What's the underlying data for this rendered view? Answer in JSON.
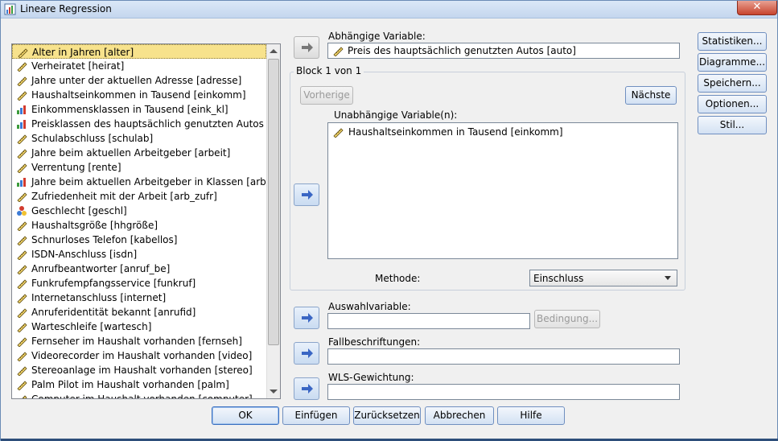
{
  "window": {
    "title": "Lineare Regression",
    "close_label": "✕"
  },
  "source_list": {
    "items": [
      {
        "label": "Alter in Jahren [alter]",
        "icon": "scale-icon",
        "selected": true
      },
      {
        "label": "Verheiratet [heirat]",
        "icon": "scale-icon"
      },
      {
        "label": "Jahre unter der aktuellen Adresse [adresse]",
        "icon": "scale-icon"
      },
      {
        "label": "Haushaltseinkommen in Tausend [einkomm]",
        "icon": "scale-icon"
      },
      {
        "label": "Einkommensklassen in Tausend [eink_kl]",
        "icon": "ordinal-icon"
      },
      {
        "label": "Preisklassen des hauptsächlich genutzten Autos [a...",
        "icon": "ordinal-icon"
      },
      {
        "label": "Schulabschluss [schulab]",
        "icon": "scale-icon"
      },
      {
        "label": "Jahre beim aktuellen Arbeitgeber [arbeit]",
        "icon": "scale-icon"
      },
      {
        "label": "Verrentung [rente]",
        "icon": "scale-icon"
      },
      {
        "label": "Jahre beim aktuellen Arbeitgeber in Klassen [arbei...",
        "icon": "ordinal-icon"
      },
      {
        "label": "Zufriedenheit mit der Arbeit [arb_zufr]",
        "icon": "scale-icon"
      },
      {
        "label": "Geschlecht [geschl]",
        "icon": "nominal-icon"
      },
      {
        "label": "Haushaltsgröße [hhgröße]",
        "icon": "scale-icon"
      },
      {
        "label": "Schnurloses Telefon [kabellos]",
        "icon": "scale-icon"
      },
      {
        "label": "ISDN-Anschluss [isdn]",
        "icon": "scale-icon"
      },
      {
        "label": "Anrufbeantworter [anruf_be]",
        "icon": "scale-icon"
      },
      {
        "label": "Funkrufempfangsservice [funkruf]",
        "icon": "scale-icon"
      },
      {
        "label": "Internetanschluss [internet]",
        "icon": "scale-icon"
      },
      {
        "label": "Anruferidentität bekannt [anrufid]",
        "icon": "scale-icon"
      },
      {
        "label": "Warteschleife [wartesch]",
        "icon": "scale-icon"
      },
      {
        "label": "Fernseher im Haushalt vorhanden [fernseh]",
        "icon": "scale-icon"
      },
      {
        "label": "Videorecorder im Haushalt vorhanden [video]",
        "icon": "scale-icon"
      },
      {
        "label": "Stereoanlage im Haushalt vorhanden [stereo]",
        "icon": "scale-icon"
      },
      {
        "label": "Palm Pilot im Haushalt vorhanden [palm]",
        "icon": "scale-icon"
      },
      {
        "label": "Computer im Haushalt vorhanden [computer]",
        "icon": "scale-icon"
      }
    ]
  },
  "dependent": {
    "label": "Abhängige Variable:",
    "value": "Preis des hauptsächlich genutzten Autos [auto]"
  },
  "block": {
    "title": "Block 1 von 1",
    "prev_label": "Vorherige",
    "next_label": "Nächste",
    "independent_label": "Unabhängige Variable(n):",
    "independent_items": [
      "Haushaltseinkommen in Tausend [einkomm]"
    ],
    "method_label": "Methode:",
    "method_value": "Einschluss"
  },
  "selection": {
    "label": "Auswahlvariable:",
    "value": "",
    "condition_label": "Bedingung..."
  },
  "case_labels": {
    "label": "Fallbeschriftungen:",
    "value": ""
  },
  "wls": {
    "label": "WLS-Gewichtung:",
    "value": ""
  },
  "side_buttons": {
    "statistics": "Statistiken...",
    "plots": "Diagramme...",
    "save": "Speichern...",
    "options": "Optionen...",
    "style": "Stil..."
  },
  "bottom_buttons": {
    "ok": "OK",
    "paste": "Einfügen",
    "reset": "Zurücksetzen",
    "cancel": "Abbrechen",
    "help": "Hilfe"
  }
}
